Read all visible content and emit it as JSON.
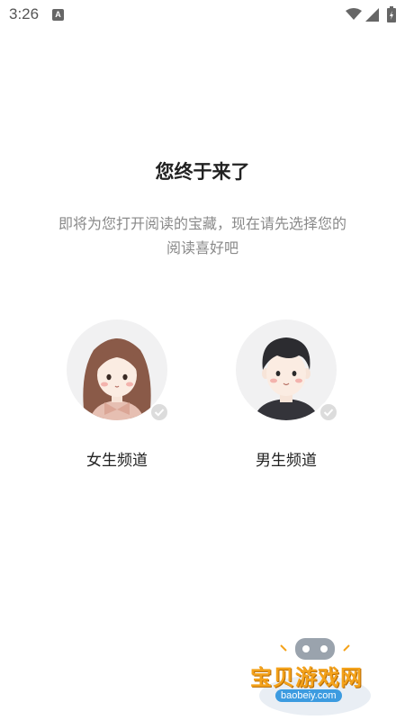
{
  "status_bar": {
    "time": "3:26",
    "notification_glyph": "A",
    "icons": [
      "wifi-icon",
      "signal-icon",
      "battery-icon"
    ]
  },
  "welcome": {
    "title": "您终于来了",
    "subtitle": "即将为您打开阅读的宝藏，现在请先选择您的阅读喜好吧"
  },
  "channels": [
    {
      "label": "女生频道",
      "icon": "girl-avatar-icon",
      "selected": false
    },
    {
      "label": "男生频道",
      "icon": "boy-avatar-icon",
      "selected": false
    }
  ],
  "watermark": {
    "text": "宝贝游戏网",
    "url": "baobeiy.com"
  },
  "colors": {
    "background": "#ffffff",
    "title": "#222222",
    "subtitle": "#8a8a8a",
    "avatar_bg": "#f1f1f2",
    "check": "#dcdcdc"
  }
}
